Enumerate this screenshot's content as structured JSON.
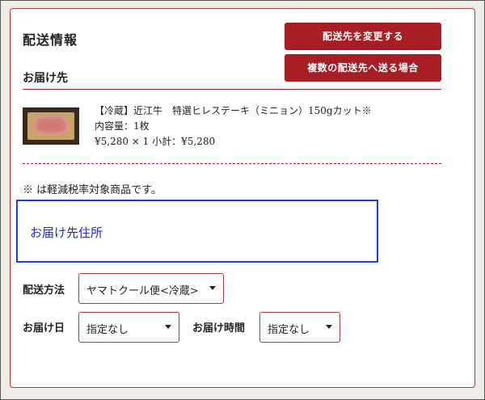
{
  "delivery": {
    "title": "配送情報",
    "recipient_label": "お届け先",
    "change_address_button": "配送先を変更する",
    "multiple_address_button": "複数の配送先へ送る場合"
  },
  "product": {
    "name": "【冷蔵】近江牛　特選ヒレステーキ（ミニョン）150gカット※",
    "content": "内容量：1枚",
    "price_line": "¥5,280 × 1 小計：¥5,280"
  },
  "note": "※ は軽減税率対象商品です。",
  "address": {
    "label": "お届け先住所"
  },
  "shipping": {
    "method_label": "配送方法",
    "method_value": "ヤマトクール便<冷蔵>",
    "date_label": "お届け日",
    "date_value": "指定なし",
    "time_label": "お届け時間",
    "time_value": "指定なし"
  },
  "colors": {
    "accent": "#a81c24",
    "highlight_border": "#1a3fe0"
  }
}
